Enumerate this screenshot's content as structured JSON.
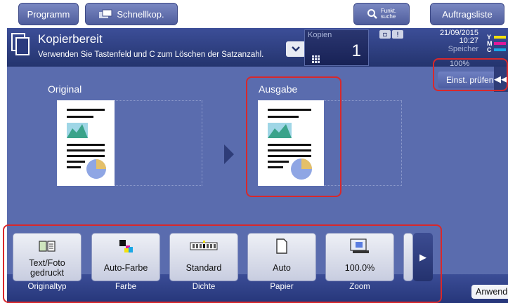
{
  "top_buttons": {
    "programm": "Programm",
    "schnellkop": "Schnellkop.",
    "funkt_line1": "Funkt.",
    "funkt_line2": "suche",
    "auftragsliste": "Auftragsliste"
  },
  "header": {
    "title": "Kopierbereit",
    "subtitle": "Verwenden Sie Tastenfeld und C zum Löschen der Satzanzahl.",
    "kopien_label": "Kopien",
    "kopien_value": "1",
    "date": "21/09/2015",
    "time": "10:27",
    "speicher": "Speicher",
    "toner": [
      {
        "letter": "Y",
        "color": "#f4e10c"
      },
      {
        "letter": "M",
        "color": "#e0189a"
      },
      {
        "letter": "C",
        "color": "#1aa7e6"
      }
    ]
  },
  "main": {
    "original_label": "Original",
    "ausgabe_label": "Ausgabe",
    "zoom_percent": "100%",
    "einst_label": "Einst. prüfen"
  },
  "toolbar": {
    "items": [
      {
        "value": "Text/Foto gedruckt",
        "category": "Originaltyp",
        "icon": "original-type-icon"
      },
      {
        "value": "Auto-Farbe",
        "category": "Farbe",
        "icon": "color-icon"
      },
      {
        "value": "Standard",
        "category": "Dichte",
        "icon": "density-icon"
      },
      {
        "value": "Auto",
        "category": "Papier",
        "icon": "paper-icon"
      },
      {
        "value": "100.0%",
        "category": "Zoom",
        "icon": "zoom-icon"
      }
    ],
    "anwendung": "Anwendung"
  },
  "colors": {
    "accent_dark": "#24346e",
    "panel": "#5a6cae",
    "highlight": "#d8282b"
  }
}
